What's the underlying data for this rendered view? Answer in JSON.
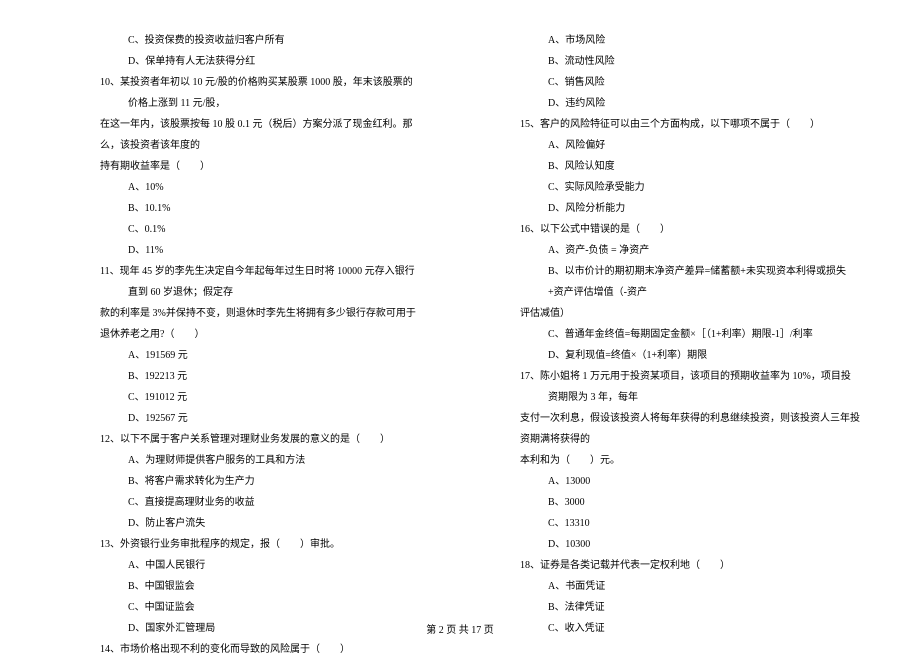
{
  "left": {
    "pre_options": [
      "C、投资保费的投资收益归客户所有",
      "D、保单持有人无法获得分红"
    ],
    "q10": {
      "lines": [
        "10、某投资者年初以 10 元/股的价格购买某股票 1000 股，年末该股票的价格上涨到 11 元/股，",
        "在这一年内，该股票按每 10 股 0.1 元（税后）方案分派了现金红利。那么，该投资者该年度的",
        "持有期收益率是（　　）"
      ],
      "opts": [
        "A、10%",
        "B、10.1%",
        "C、0.1%",
        "D、11%"
      ]
    },
    "q11": {
      "lines": [
        "11、现年 45 岁的李先生决定自今年起每年过生日时将 10000 元存入银行直到 60 岁退休；假定存",
        "款的利率是 3%并保持不变，则退休时李先生将拥有多少银行存款可用于退休养老之用?（　　）"
      ],
      "opts": [
        "A、191569 元",
        "B、192213 元",
        "C、191012 元",
        "D、192567 元"
      ]
    },
    "q12": {
      "lines": [
        "12、以下不属于客户关系管理对理财业务发展的意义的是（　　）"
      ],
      "opts": [
        "A、为理财师提供客户服务的工具和方法",
        "B、将客户需求转化为生产力",
        "C、直接提高理财业务的收益",
        "D、防止客户流失"
      ]
    },
    "q13": {
      "lines": [
        "13、外资银行业务审批程序的规定，报（　　）审批。"
      ],
      "opts": [
        "A、中国人民银行",
        "B、中国银监会",
        "C、中国证监会",
        "D、国家外汇管理局"
      ]
    },
    "q14": {
      "lines": [
        "14、市场价格出现不利的变化而导致的风险属于（　　）"
      ]
    }
  },
  "right": {
    "q14_opts": [
      "A、市场风险",
      "B、流动性风险",
      "C、销售风险",
      "D、违约风险"
    ],
    "q15": {
      "lines": [
        "15、客户的风险特征可以由三个方面构成，以下哪项不属于（　　）"
      ],
      "opts": [
        "A、风险偏好",
        "B、风险认知度",
        "C、实际风险承受能力",
        "D、风险分析能力"
      ]
    },
    "q16": {
      "lines": [
        "16、以下公式中错误的是（　　）"
      ],
      "opts": [
        "A、资产-负债 = 净资产",
        "B、以市价计的期初期末净资产差异=储蓄额+未实现资本利得或损失+资产评估增值（-资产",
        "C、普通年金终值=每期固定金额×［（1+利率）期限-1］/利率",
        "D、复利现值=终值×（1+利率）期限"
      ],
      "opt_b_cont": "评估减值）"
    },
    "q17": {
      "lines": [
        "17、陈小姐将 1 万元用于投资某项目，该项目的预期收益率为 10%，项目投资期限为 3 年，每年",
        "支付一次利息，假设该投资人将每年获得的利息继续投资，则该投资人三年投资期满将获得的",
        "本利和为（　　）元。"
      ],
      "opts": [
        "A、13000",
        "B、3000",
        "C、13310",
        "D、10300"
      ]
    },
    "q18": {
      "lines": [
        "18、证券是各类记载并代表一定权利地（　　）"
      ],
      "opts": [
        "A、书面凭证",
        "B、法律凭证",
        "C、收入凭证"
      ]
    }
  },
  "footer": "第 2 页 共 17 页"
}
